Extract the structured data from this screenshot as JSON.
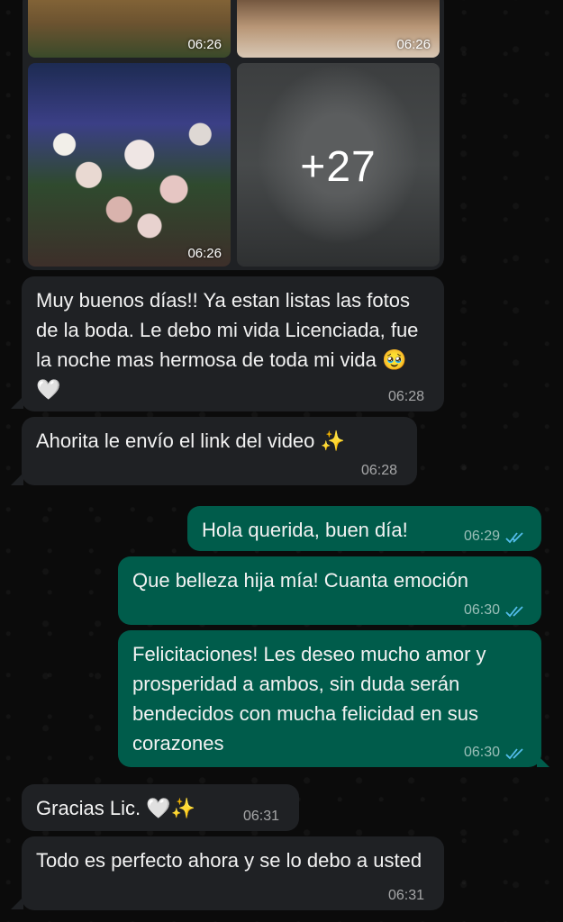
{
  "album": {
    "photo_times": [
      "06:26",
      "06:26",
      "06:26"
    ],
    "more_count": "+27"
  },
  "messages": [
    {
      "text": "Muy buenos días!! Ya estan listas las fotos de la boda. Le debo mi vida Licenciada, fue la noche mas hermosa de toda mi vida 🥹🤍",
      "time": "06:28",
      "direction": "in"
    },
    {
      "text": "Ahorita le envío el link del video ✨",
      "time": "06:28",
      "direction": "in"
    },
    {
      "text": "Hola querida, buen día!",
      "time": "06:29",
      "direction": "out",
      "read": true
    },
    {
      "text": "Que belleza hija mía! Cuanta emoción",
      "time": "06:30",
      "direction": "out",
      "read": true
    },
    {
      "text": "Felicitaciones! Les deseo mucho amor y prosperidad a ambos, sin duda serán bendecidos con mucha felicidad en sus corazones",
      "time": "06:30",
      "direction": "out",
      "read": true
    },
    {
      "text": "Gracias Lic. 🤍✨",
      "time": "06:31",
      "direction": "in"
    },
    {
      "text": "Todo es perfecto ahora y se lo debo a usted",
      "time": "06:31",
      "direction": "in"
    }
  ],
  "colors": {
    "incoming_bubble": "#1f2124",
    "outgoing_bubble": "#005c4b",
    "read_ticks": "#53bdeb",
    "background": "#0b0b0b"
  }
}
